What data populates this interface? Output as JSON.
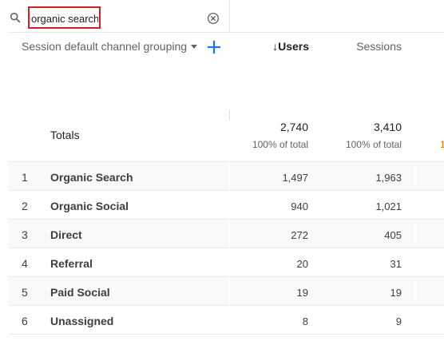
{
  "search": {
    "value": "organic search",
    "placeholder": ""
  },
  "header": {
    "dimension_label": "Session default channel grouping",
    "users_label": "↓Users",
    "sessions_label": "Sessions"
  },
  "totals": {
    "label": "Totals",
    "users": "2,740",
    "users_pct": "100% of total",
    "sessions": "3,410",
    "sessions_pct": "100% of total",
    "next_col_fragment": "1"
  },
  "rows": [
    {
      "index": "1",
      "name": "Organic Search",
      "users": "1,497",
      "sessions": "1,963"
    },
    {
      "index": "2",
      "name": "Organic Social",
      "users": "940",
      "sessions": "1,021"
    },
    {
      "index": "3",
      "name": "Direct",
      "users": "272",
      "sessions": "405"
    },
    {
      "index": "4",
      "name": "Referral",
      "users": "20",
      "sessions": "31"
    },
    {
      "index": "5",
      "name": "Paid Social",
      "users": "19",
      "sessions": "19"
    },
    {
      "index": "6",
      "name": "Unassigned",
      "users": "8",
      "sessions": "9"
    }
  ],
  "colors": {
    "highlight_border": "#d3202a",
    "accent_blue": "#1a73e8",
    "row_shade": "#f8f9fa"
  },
  "icons": {
    "search": "search-icon",
    "clear": "clear-circle-x-icon",
    "add": "plus-icon",
    "dropdown": "caret-down-icon"
  }
}
